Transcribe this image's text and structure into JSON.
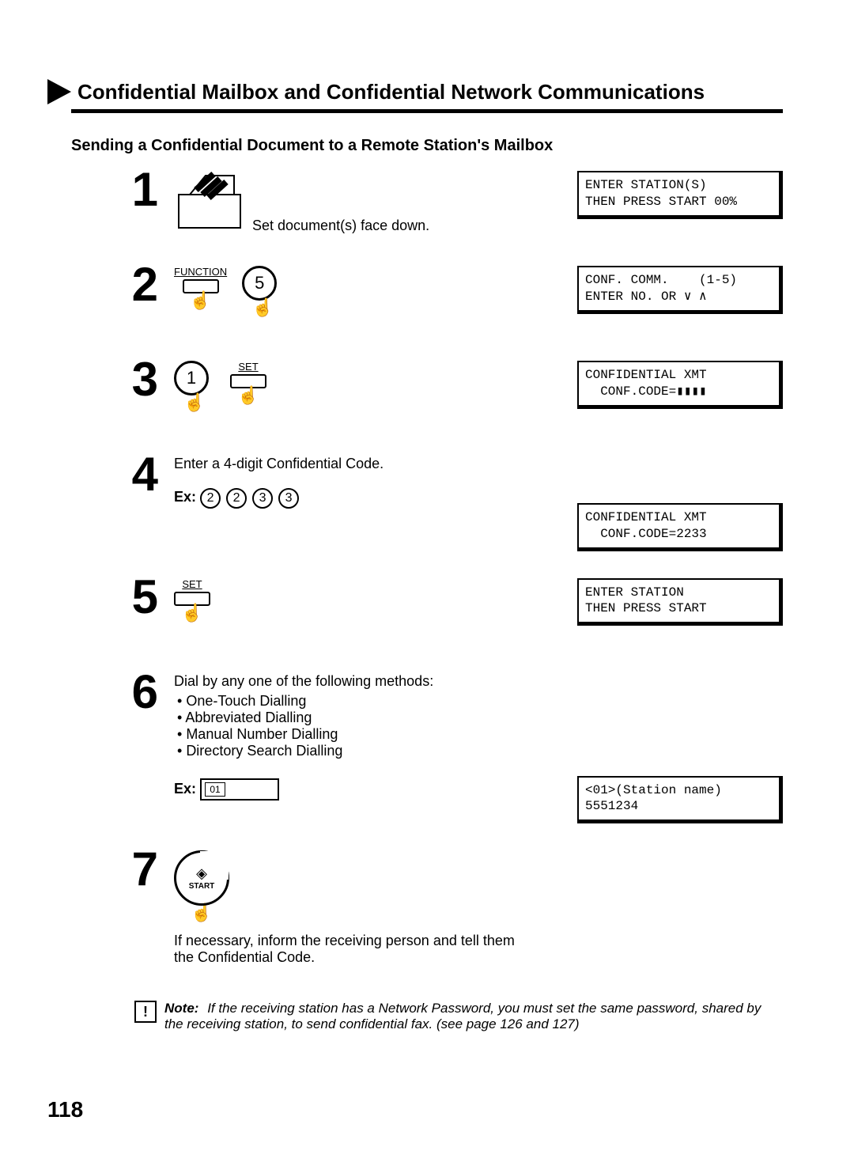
{
  "title": "Confidential Mailbox and Confidential Network Communications",
  "subtitle": "Sending a Confidential Document to a Remote Station's Mailbox",
  "steps": {
    "s1": {
      "num": "1",
      "caption": "Set document(s) face down.",
      "lcd": "ENTER STATION(S)\nTHEN PRESS START 00%"
    },
    "s2": {
      "num": "2",
      "function_label": "FUNCTION",
      "digit": "5",
      "lcd": "CONF. COMM.    (1-5)\nENTER NO. OR ∨ ∧"
    },
    "s3": {
      "num": "3",
      "digit": "1",
      "set_label": "SET",
      "lcd": "CONFIDENTIAL XMT\n  CONF.CODE=▮▮▮▮"
    },
    "s4": {
      "num": "4",
      "text": "Enter a 4-digit Confidential Code.",
      "ex_label": "Ex:",
      "digits": [
        "2",
        "2",
        "3",
        "3"
      ],
      "lcd": "CONFIDENTIAL XMT\n  CONF.CODE=2233"
    },
    "s5": {
      "num": "5",
      "set_label": "SET",
      "lcd": "ENTER STATION\nTHEN PRESS START"
    },
    "s6": {
      "num": "6",
      "text": "Dial by any one of the following methods:",
      "bullets": [
        "One-Touch Dialling",
        "Abbreviated Dialling",
        "Manual Number Dialling",
        "Directory Search Dialling"
      ],
      "ex_label": "Ex:",
      "ex_key": "01",
      "lcd": "<01>(Station name)\n5551234"
    },
    "s7": {
      "num": "7",
      "start_label": "START",
      "text": "If necessary, inform the receiving person and tell them the Confidential Code."
    }
  },
  "note": {
    "label": "Note:",
    "text": "If the receiving station has a Network Password, you must set the same password, shared by the receiving station, to send confidential fax. (see page 126 and 127)"
  },
  "pagenum": "118"
}
